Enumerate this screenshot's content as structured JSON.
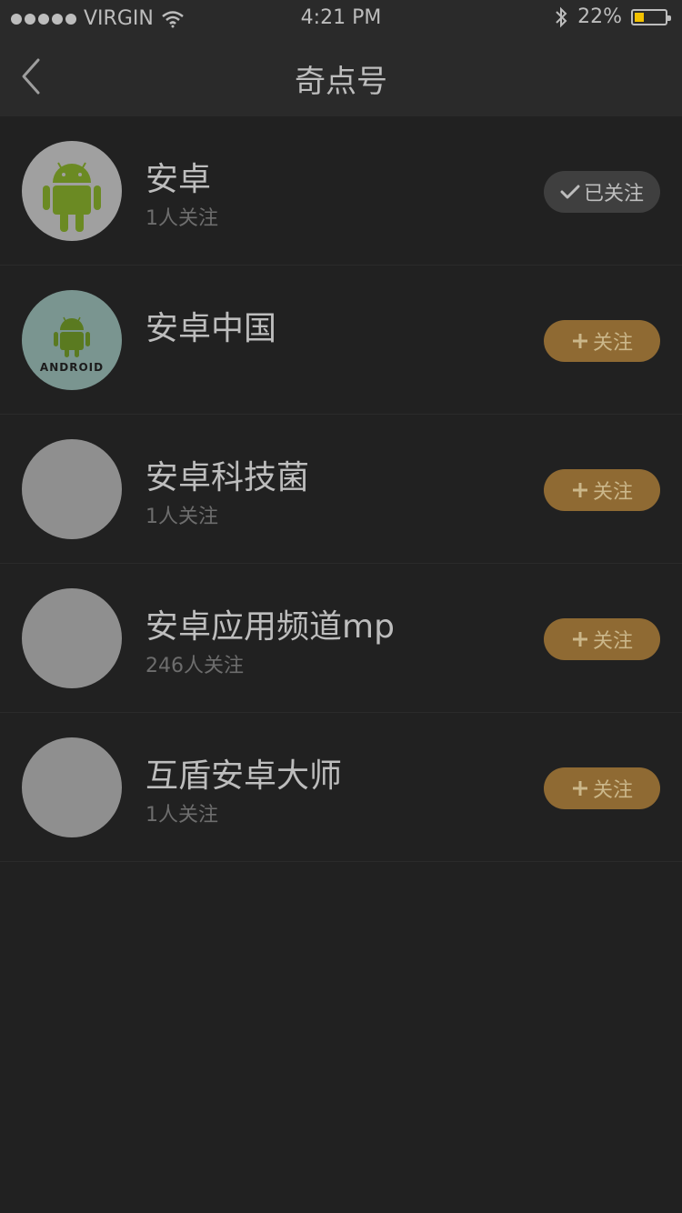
{
  "status_bar": {
    "carrier": "VIRGIN",
    "time": "4:21 PM",
    "battery_percent": "22%",
    "battery_level": 0.22,
    "battery_color": "#f2c100"
  },
  "nav": {
    "title": "奇点号",
    "back_icon": "chevron-left-icon"
  },
  "accounts": [
    {
      "name": "安卓",
      "followers": "1人关注",
      "button_label": "已关注",
      "followed": true,
      "avatar": "android-robot-logo"
    },
    {
      "name": "安卓中国",
      "followers": "",
      "button_label": "关注",
      "followed": false,
      "avatar": "android-logo-with-wordmark",
      "avatar_wordmark": "ANDROID"
    },
    {
      "name": "安卓科技菌",
      "followers": "1人关注",
      "button_label": "关注",
      "followed": false,
      "avatar": "placeholder"
    },
    {
      "name": "安卓应用频道mp",
      "followers": "246人关注",
      "button_label": "关注",
      "followed": false,
      "avatar": "placeholder"
    },
    {
      "name": "互盾安卓大师",
      "followers": "1人关注",
      "button_label": "关注",
      "followed": false,
      "avatar": "placeholder"
    }
  ],
  "colors": {
    "background": "#212121",
    "follow_button": "#8f6a33",
    "followed_button": "#3f3f3f",
    "android_green": "#6b8a23"
  }
}
